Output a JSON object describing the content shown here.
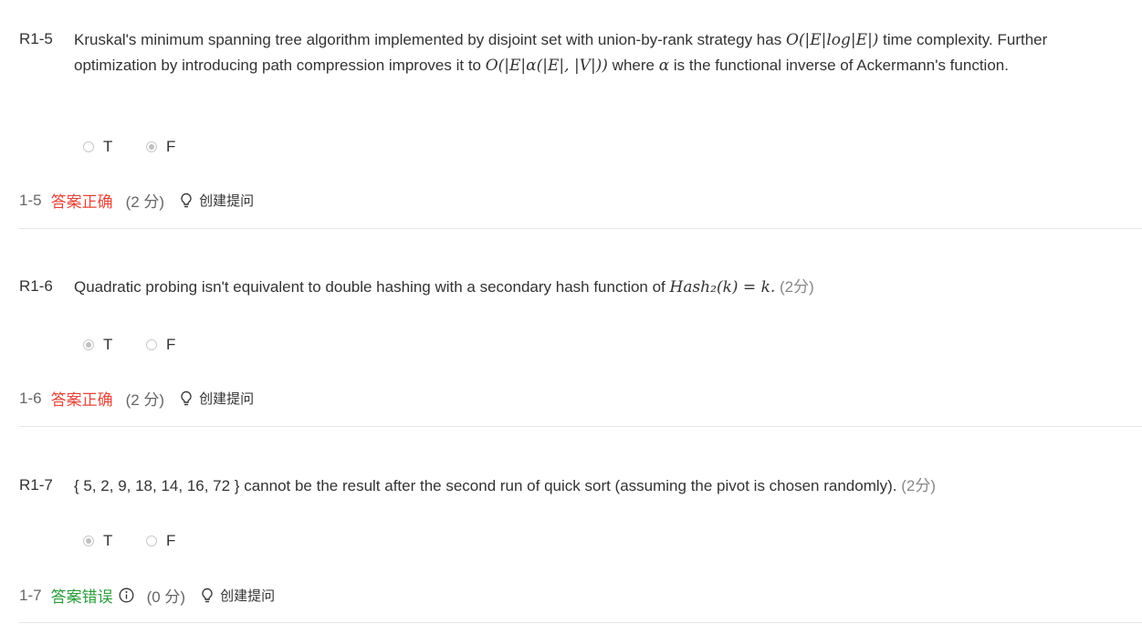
{
  "questions": [
    {
      "num": "R1-5",
      "text_1": "Kruskal's minimum spanning tree algorithm implemented by disjoint set with union-by-rank strategy has ",
      "math_1": "O(|E|log|E|)",
      "text_2": " time complexity. Further optimization by introducing path compression improves it to ",
      "math_2": "O(|E|α(|E|, |V|))",
      "text_3": " where ",
      "math_3": "α",
      "text_4": " is the functional inverse of Ackermann's function.",
      "options": [
        {
          "label": "T",
          "checked": false
        },
        {
          "label": "F",
          "checked": true
        }
      ],
      "result": {
        "index": "1-5",
        "status": "答案正确",
        "points": "(2 分)",
        "ask": "创建提问"
      }
    },
    {
      "num": "R1-6",
      "text_1": "Quadratic probing isn't equivalent to double hashing with a secondary hash function of ",
      "math_1": "Hash₂(k) = k.",
      "score": "(2分)",
      "options": [
        {
          "label": "T",
          "checked": true
        },
        {
          "label": "F",
          "checked": false
        }
      ],
      "result": {
        "index": "1-6",
        "status": "答案正确",
        "points": "(2 分)",
        "ask": "创建提问"
      }
    },
    {
      "num": "R1-7",
      "text_1": "{ 5, 2, 9, 18, 14, 16, 72 } cannot be the result after the second run of quick sort (assuming the pivot is chosen randomly).",
      "score": "(2分)",
      "options": [
        {
          "label": "T",
          "checked": true
        },
        {
          "label": "F",
          "checked": false
        }
      ],
      "result": {
        "index": "1-7",
        "status": "答案错误",
        "points": "(0 分)",
        "ask": "创建提问"
      }
    }
  ],
  "colors": {
    "correct": "#e5453a",
    "wrong": "#2a9d3b",
    "divider": "#e6e6e6"
  }
}
